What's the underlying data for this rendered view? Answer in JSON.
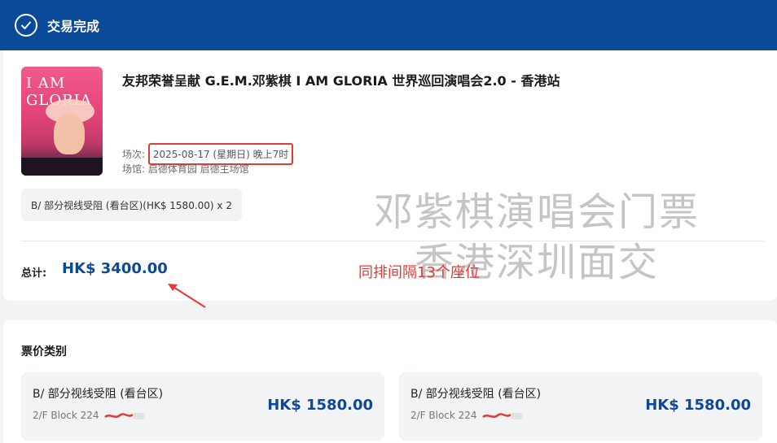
{
  "header": {
    "status_title": "交易完成"
  },
  "order": {
    "event_title": "友邦荣誉呈献 G.E.M.邓紫棋 I AM GLORIA 世界巡回演唱会2.0 - 香港站",
    "poster_text": "I AM GLORIA",
    "session_label": "场次: ",
    "session_value": "2025-08-17 (星期日) 晚上7时",
    "venue_label": "场馆: ",
    "venue_value": "启德体育园 启德主场馆",
    "ticket_summary": "B/ 部分视线受阻 (看台区)(HK$ 1580.00) x 2",
    "total_label": "总计: ",
    "total_value": "HK$ 3400.00",
    "annotation_note": "同排间隔13个座位",
    "watermark_line1": "邓紫棋演唱会门票",
    "watermark_line2": "香港深圳面交"
  },
  "prices": {
    "section_title": "票价类别",
    "items": [
      {
        "name": "B/ 部分视线受阻 (看台区)",
        "seat": "2/F Block 224",
        "price": "HK$ 1580.00"
      },
      {
        "name": "B/ 部分视线受阻 (看台区)",
        "seat": "2/F Block 224",
        "price": "HK$ 1580.00"
      }
    ]
  },
  "colors": {
    "brand_blue": "#0a4a99",
    "highlight_red": "#e53935"
  }
}
